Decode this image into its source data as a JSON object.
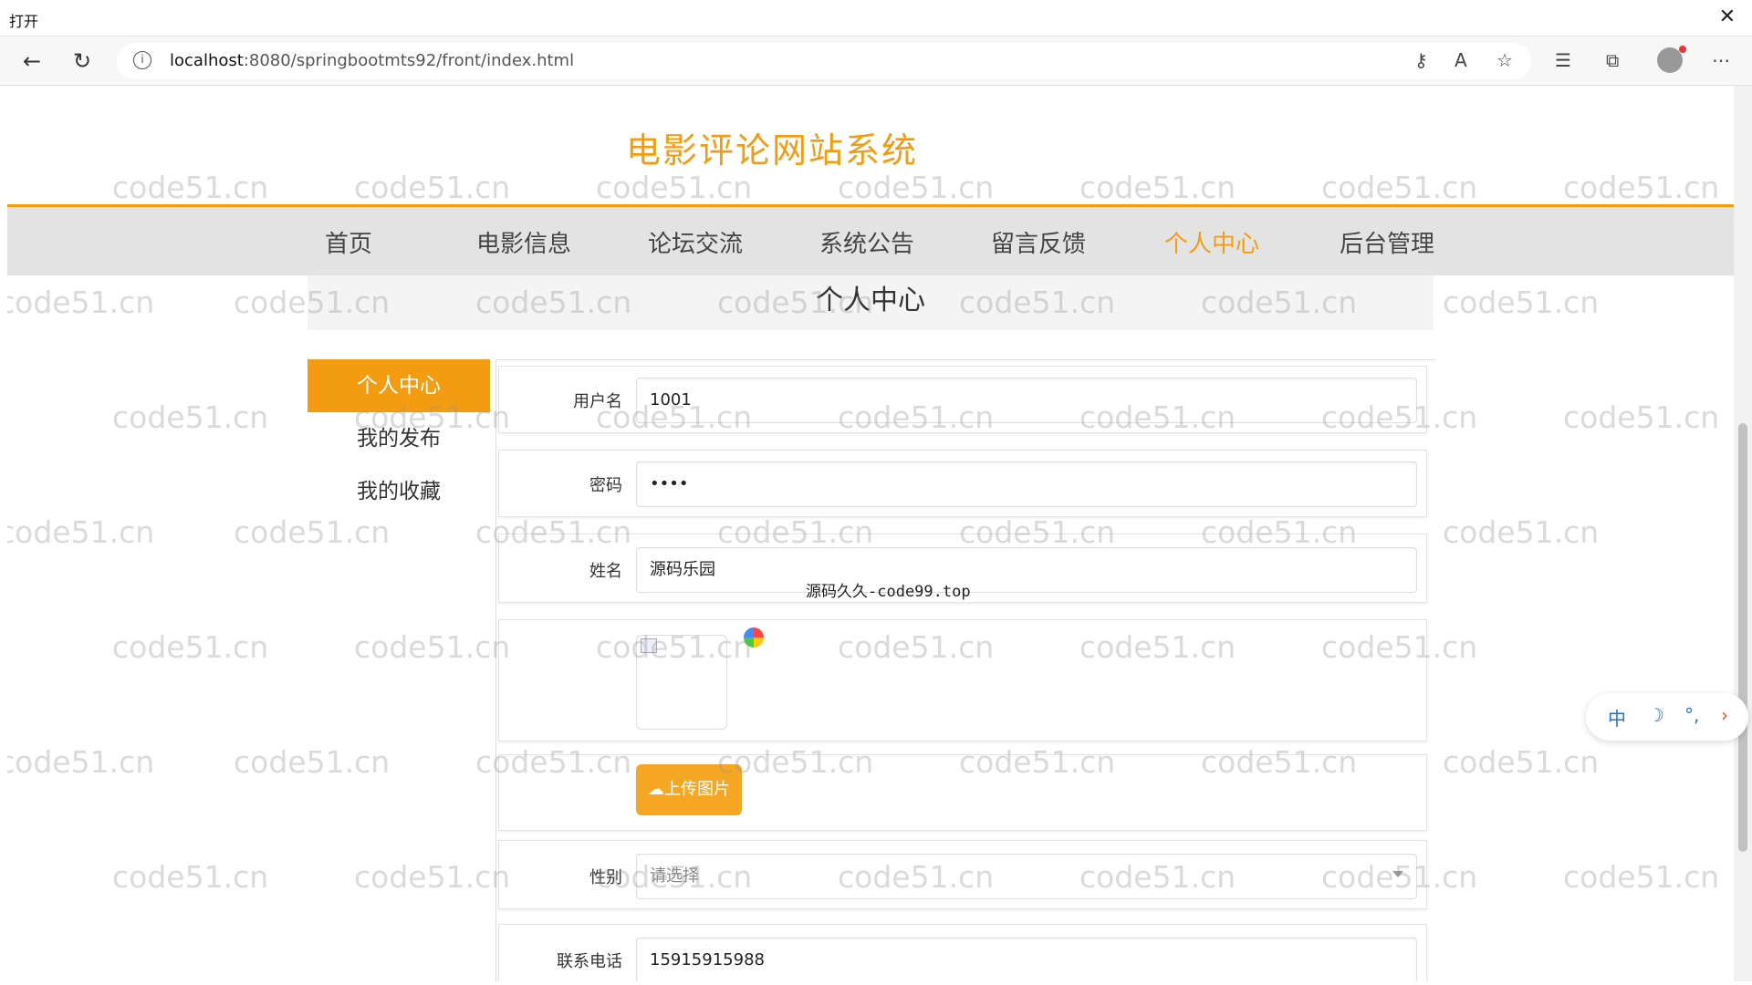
{
  "window": {
    "title": "打开",
    "close": "✕"
  },
  "browser": {
    "url_host": "localhost",
    "url_path": ":8080/springbootmts92/front/index.html",
    "icons": [
      "back-icon",
      "refresh-icon",
      "info-icon",
      "key-icon",
      "read-aloud-icon",
      "favorite-add-icon",
      "favorites-icon",
      "collections-icon",
      "profile-icon",
      "more-icon"
    ]
  },
  "site": {
    "title": "电影评论网站系统"
  },
  "nav": {
    "items": [
      "首页",
      "电影信息",
      "论坛交流",
      "系统公告",
      "留言反馈",
      "个人中心",
      "后台管理"
    ],
    "active": "个人中心"
  },
  "section": {
    "heading": "个人中心"
  },
  "sidebar": {
    "items": [
      "个人中心",
      "我的发布",
      "我的收藏"
    ],
    "active": "个人中心"
  },
  "form": {
    "username_label": "用户名",
    "username_value": "1001",
    "password_label": "密码",
    "password_value": "••••",
    "name_label": "姓名",
    "name_value": "源码乐园",
    "upload_label": "上传图片",
    "gender_label": "性别",
    "gender_placeholder": "请选择",
    "phone_label": "联系电话",
    "phone_value": "15915915988"
  },
  "overlay": {
    "text": "源码久久-code99.top"
  },
  "watermark": {
    "text": "code51.cn"
  },
  "ime": {
    "lang": "中",
    "moon": "☽",
    "punct": "°,",
    "arrow": "›"
  },
  "colors": {
    "accent": "#f39c12",
    "nav_bg": "#e3e3e3"
  }
}
